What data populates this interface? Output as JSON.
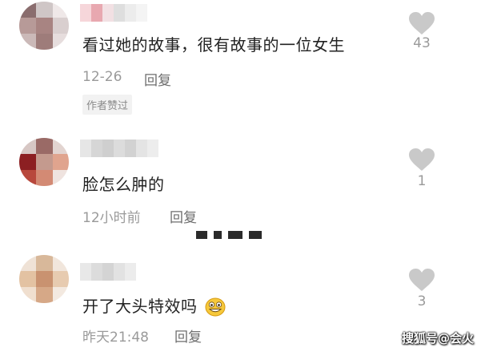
{
  "comments": [
    {
      "text": "看过她的故事，很有故事的一位女生",
      "time": "12-26",
      "reply": "回复",
      "badge": "作者赞过",
      "likes": "43"
    },
    {
      "text": "脸怎么肿的",
      "time": "12小时前",
      "reply": "回复",
      "likes": "1"
    },
    {
      "text": "开了大头特效吗",
      "time": "昨天21:48",
      "reply": "回复",
      "likes": "3",
      "emoji": "grinning-face-emoji"
    }
  ],
  "watermark": "搜狐号@会火",
  "colors": {
    "text": "#222222",
    "meta": "#9a9a9a",
    "like_icon": "#c9c9c9"
  },
  "icons": {
    "like": "heart-icon"
  }
}
